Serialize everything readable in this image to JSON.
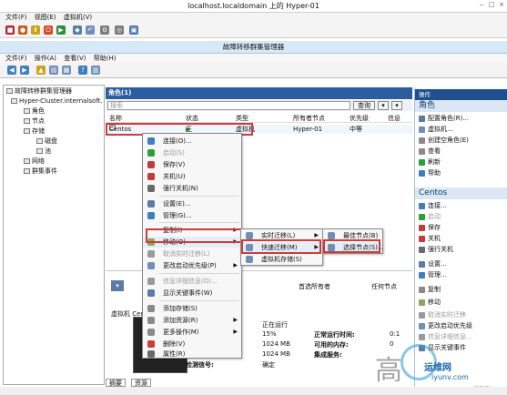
{
  "window_title": "localhost.localdomain 上的 Hyper-01",
  "vm_menu": [
    "文件(F)",
    "视图(E)",
    "虚拟机(V)"
  ],
  "fcm_title": "故障转移群集管理器",
  "fcm_menu": [
    "文件(F)",
    "操作(A)",
    "查看(V)",
    "帮助(H)"
  ],
  "tree": {
    "root": "故障转移群集管理器",
    "cluster": "Hyper-Cluster.internalsoft.",
    "items": [
      "角色",
      "节点",
      "存储",
      "磁盘",
      "池",
      "网络",
      "群集事件"
    ]
  },
  "center": {
    "header": "角色(1)",
    "search_placeholder": "搜索",
    "query_label": "查询",
    "columns": [
      "名称",
      "状态",
      "类型",
      "所有者节点",
      "优先级",
      "信息"
    ],
    "row": {
      "name": "Centos",
      "status": "正在运行",
      "type": "虚拟机",
      "owner": "Hyper-01",
      "priority": "中等"
    }
  },
  "context_menu": [
    {
      "label": "连接(O)...",
      "icon_color": "#3f7fbf",
      "enabled": true,
      "submenu": false
    },
    {
      "label": "启动(S)",
      "icon_color": "#2e9d3a",
      "enabled": true,
      "submenu": false
    },
    {
      "label": "保存(V)",
      "icon_color": "#c23b3b",
      "enabled": true,
      "submenu": false
    },
    {
      "label": "关机(U)",
      "icon_color": "#c23b3b",
      "enabled": true,
      "submenu": false
    },
    {
      "label": "强行关机(N)",
      "icon_color": "#6a6a6a",
      "enabled": true,
      "submenu": false
    },
    {
      "label": "设置(E)...",
      "icon_color": "#5b7aa8",
      "enabled": true,
      "submenu": false
    },
    {
      "label": "管理(G)...",
      "icon_color": "#3f7fbf",
      "enabled": true,
      "submenu": false
    },
    {
      "label": "复制(I)",
      "icon_color": "",
      "enabled": true,
      "submenu": true
    },
    {
      "label": "移动(O)",
      "icon_color": "#8aa85a",
      "enabled": true,
      "submenu": true
    },
    {
      "label": "取消实时迁移(L)",
      "icon_color": "#9a9a9a",
      "enabled": false,
      "submenu": false
    },
    {
      "label": "更改启动优先级(P)",
      "icon_color": "#6f8fb6",
      "enabled": true,
      "submenu": true
    },
    {
      "label": "信息详细信息(D)...",
      "icon_color": "#9a9a9a",
      "enabled": false,
      "submenu": false
    },
    {
      "label": "显示关键事件(W)",
      "icon_color": "#5b7aa8",
      "enabled": true,
      "submenu": false
    },
    {
      "label": "添加存储(S)",
      "icon_color": "#8a8a8a",
      "enabled": true,
      "submenu": false
    },
    {
      "label": "添加资源(R)",
      "icon_color": "#8a8a8a",
      "enabled": true,
      "submenu": true
    },
    {
      "label": "更多操作(M)",
      "icon_color": "#8a8a8a",
      "enabled": true,
      "submenu": true
    },
    {
      "label": "删除(V)",
      "icon_color": "#d23a3a",
      "enabled": true,
      "submenu": false
    },
    {
      "label": "属性(R)",
      "icon_color": "#6a6a6a",
      "enabled": true,
      "submenu": false
    }
  ],
  "submenu_move": [
    {
      "label": "实时迁移(L)",
      "icon_color": "#6f8fb6"
    },
    {
      "label": "快速迁移(M)",
      "icon_color": "#6f8fb6"
    },
    {
      "label": "虚拟机存储(S)",
      "icon_color": "#6f8fb6"
    }
  ],
  "submenu_quick": [
    {
      "label": "最佳节点(B)",
      "icon_color": "#6f8fb6"
    },
    {
      "label": "选择节点(S)...",
      "icon_color": "#6f8fb6"
    }
  ],
  "details": {
    "owner_label": "首选所有者",
    "owner_value": "任何节点",
    "vm_label": "虚拟机 Centos",
    "status": "正在运行",
    "cpu": "15%",
    "mem1": "1024 MB",
    "mem2": "1024 MB",
    "uptime_label": "正常运行时间:",
    "uptime_value": "0:1",
    "avail_label": "可用的内存:",
    "avail_value": "0",
    "integration_label": "集成服务:",
    "heartbeat_label": "检测信号:",
    "heartbeat_value": "确定"
  },
  "bottom_tabs": [
    "摘要",
    "资源"
  ],
  "actions": {
    "section1": "角色",
    "items1": [
      "配置角色(R)...",
      "虚拟机...",
      "创建空角色(E)",
      "查看",
      "刷新",
      "帮助"
    ],
    "section2": "Centos",
    "items2": [
      "连接...",
      "启动",
      "保存",
      "关机",
      "强行关机",
      "设置...",
      "管理...",
      "复制",
      "移动",
      "取消实时迁移",
      "更改启动优先级",
      "信息详细信息...",
      "显示关键事件"
    ]
  },
  "watermark": {
    "glyph": "高",
    "brand": "亿速云",
    "logo_text": "运维网",
    "url": "iyunv.com"
  }
}
